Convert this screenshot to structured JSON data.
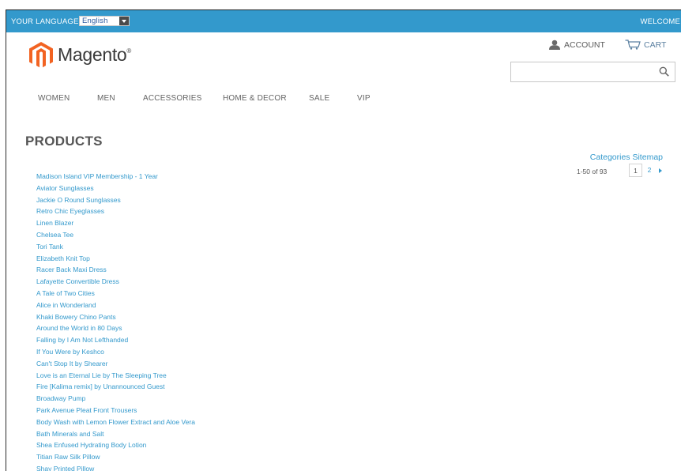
{
  "header": {
    "language_label": "YOUR LANGUAGE:",
    "language_value": "English",
    "welcome": "WELCOME",
    "logo_text": "Magento",
    "logo_mark": "®",
    "account_label": "ACCOUNT",
    "cart_label": "CART",
    "search_placeholder": ""
  },
  "nav": {
    "items": [
      "WOMEN",
      "MEN",
      "ACCESSORIES",
      "HOME & DECOR",
      "SALE",
      "VIP"
    ]
  },
  "main": {
    "title": "PRODUCTS",
    "sitemap_link": "Categories Sitemap",
    "count_text": "1-50 of 93",
    "pages": [
      "1",
      "2"
    ],
    "products": [
      "Madison Island VIP Membership - 1 Year",
      "Aviator Sunglasses",
      "Jackie O Round Sunglasses",
      "Retro Chic Eyeglasses",
      "Linen Blazer",
      "Chelsea Tee",
      "Tori Tank",
      "Elizabeth Knit Top",
      "Racer Back Maxi Dress",
      "Lafayette Convertible Dress",
      "A Tale of Two Cities",
      "Alice in Wonderland",
      "Khaki Bowery Chino Pants",
      "Around the World in 80 Days",
      "Falling by I Am Not Lefthanded",
      "If You Were by Keshco",
      "Can't Stop It by Shearer",
      "Love is an Eternal Lie by The Sleeping Tree",
      "Fire [Kalima remix] by Unannounced Guest",
      "Broadway Pump",
      "Park Avenue Pleat Front Trousers",
      "Body Wash with Lemon Flower Extract and Aloe Vera",
      "Bath Minerals and Salt",
      "Shea Enfused Hydrating Body Lotion",
      "Titian Raw Silk Pillow",
      "Shay Printed Pillow"
    ]
  },
  "colors": {
    "topbar": "#3399cc",
    "link": "#3399cc",
    "logo_orange": "#f26322"
  },
  "icons": {
    "language_dropdown": "chevron-down-icon",
    "account": "user-icon",
    "cart": "cart-icon",
    "search": "search-icon",
    "logo": "magento-logo-icon",
    "next": "chevron-right-icon"
  }
}
